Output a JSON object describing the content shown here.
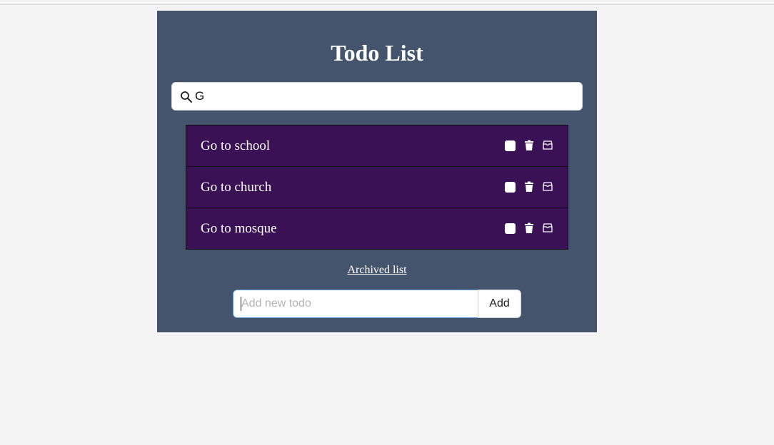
{
  "app": {
    "title": "Todo List"
  },
  "search": {
    "value": "G",
    "icon": "search-icon"
  },
  "todos": [
    {
      "text": "Go to school",
      "done": false
    },
    {
      "text": "Go to church",
      "done": false
    },
    {
      "text": "Go to mosque",
      "done": false
    }
  ],
  "item_actions": {
    "icons": [
      "checkbox",
      "trash-icon",
      "archive-icon"
    ]
  },
  "archived_link": {
    "label": "Archived list"
  },
  "add_form": {
    "placeholder": "Add new todo",
    "value": "",
    "button_label": "Add"
  },
  "colors": {
    "page_background": "#f4f4f4",
    "panel_background": "#44546c",
    "item_background": "#3a1154",
    "input_focus_border": "#5b9bd5"
  }
}
